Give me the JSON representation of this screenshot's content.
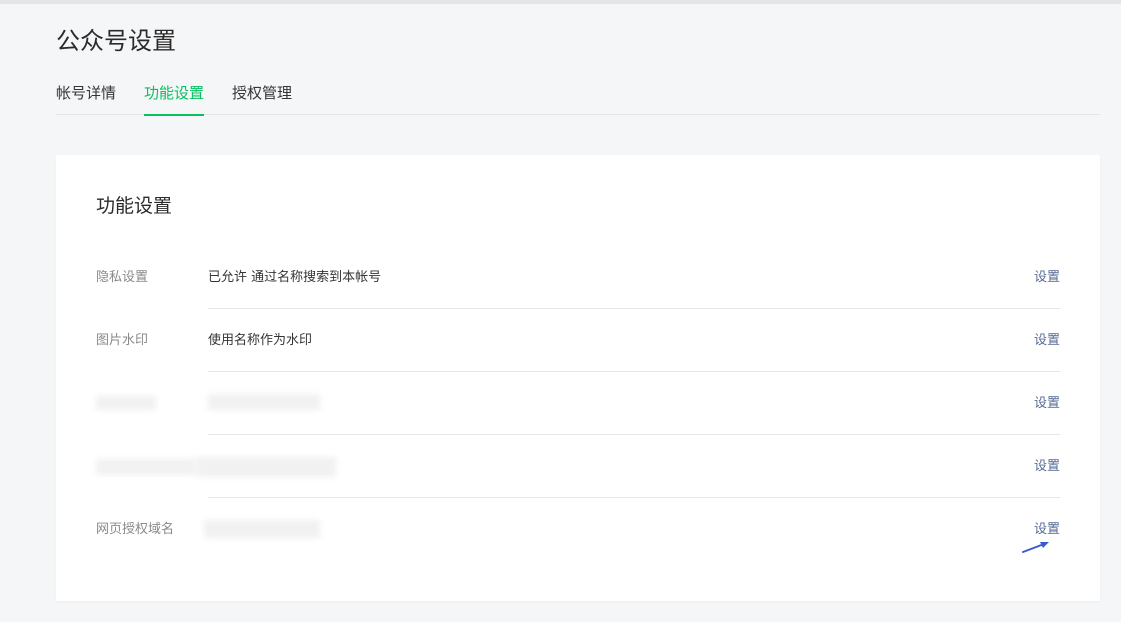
{
  "page": {
    "title": "公众号设置"
  },
  "tabs": [
    {
      "label": "帐号详情",
      "active": false
    },
    {
      "label": "功能设置",
      "active": true
    },
    {
      "label": "授权管理",
      "active": false
    }
  ],
  "card": {
    "title": "功能设置",
    "rows": [
      {
        "label": "隐私设置",
        "value": "已允许 通过名称搜索到本帐号",
        "action": "设置"
      },
      {
        "label": "图片水印",
        "value": "使用名称作为水印",
        "action": "设置"
      },
      {
        "label": "",
        "value": "",
        "action": "设置"
      },
      {
        "label": "",
        "value": "",
        "action": "设置"
      },
      {
        "label": "网页授权域名",
        "value": "",
        "action": "设置"
      }
    ]
  },
  "colors": {
    "accent": "#07c160",
    "link": "#576b95",
    "background": "#f4f6f7"
  }
}
